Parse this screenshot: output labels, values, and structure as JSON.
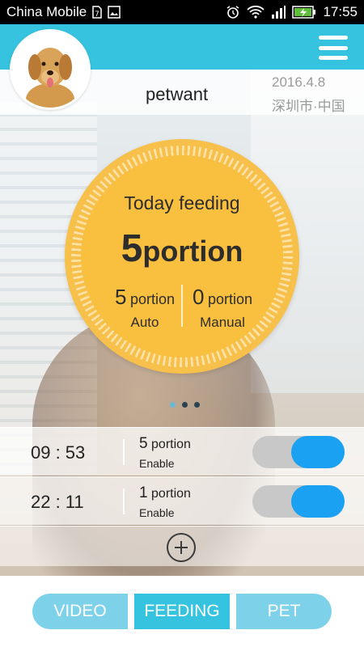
{
  "status_bar": {
    "carrier": "China Mobile",
    "time": "17:55",
    "icons": [
      "sim-7-icon",
      "image-icon",
      "alarm-icon",
      "wifi-icon",
      "signal-icon",
      "battery-charging-icon"
    ]
  },
  "header": {
    "menu_icon": "hamburger-menu-icon",
    "accent_color": "#36c3df"
  },
  "profile": {
    "username": "petwant",
    "date": "2016.4.8",
    "location": "深圳市·中国"
  },
  "feeding": {
    "title": "Today feeding",
    "total_value": "5",
    "total_unit": "portion",
    "auto_value": "5",
    "auto_unit": "portion",
    "auto_label": "Auto",
    "manual_value": "0",
    "manual_unit": "portion",
    "manual_label": "Manual",
    "circle_color": "#f9bf3f"
  },
  "pager": {
    "page_count": 3,
    "active_index": 0
  },
  "schedule": [
    {
      "time": "09 : 53",
      "amount": "5",
      "unit": "portion",
      "status": "Enable",
      "enabled": true
    },
    {
      "time": "22 : 11",
      "amount": "1",
      "unit": "portion",
      "status": "Enable",
      "enabled": true
    }
  ],
  "toggle_on_color": "#1aa1f1",
  "add_icon": "add-circle-icon",
  "bottom_nav": {
    "tabs": [
      {
        "label": "VIDEO",
        "active": false
      },
      {
        "label": "FEEDING",
        "active": true
      },
      {
        "label": "PET",
        "active": false
      }
    ]
  }
}
